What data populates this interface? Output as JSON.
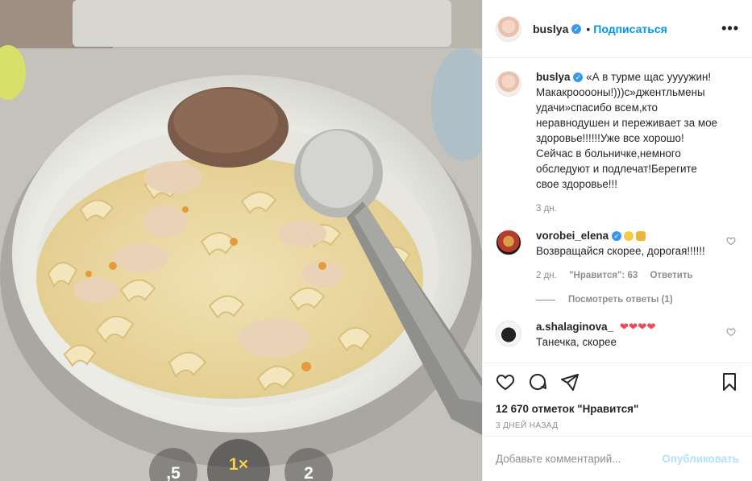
{
  "post": {
    "author": "buslya",
    "follow_label": "Подписаться",
    "dot": "•",
    "more_label": "•••"
  },
  "caption": {
    "author": "buslya",
    "text": "«А в турме щас уууужин! Макакрооооны!)))с»джентльмены удачи»спасибо всем,кто неравнодушен и переживает за мое здоровье!!!!!!Уже все хорошо!Сейчас в больничке,немного обследуют и подлечат!Берегите свое здоровье!!!",
    "time": "3 дн."
  },
  "comments": [
    {
      "author": "vorobei_elena",
      "text": "Возвращайся скорее, дорогая!!!!!!",
      "time": "2 дн.",
      "likes": "\"Нравится\": 63",
      "reply_label": "Ответить",
      "view_replies": "Посмотреть ответы (1)"
    },
    {
      "author": "a.shalaginova_",
      "text": "Танечка, скорее"
    }
  ],
  "actions": {
    "likes_count": "12 670 отметок \"Нравится\"",
    "date": "3 ДНЕЙ НАЗАД"
  },
  "add_comment": {
    "placeholder": "Добавьте комментарий...",
    "publish_label": "Опубликовать"
  },
  "photo": {
    "zoom_options": [
      ",5",
      "1×",
      "2"
    ],
    "zoom_active": "1×"
  },
  "colors": {
    "accent": "#0095f6",
    "verified": "#3897f0",
    "heart_red": "#ed4956",
    "zoom_active": "#f6d24a"
  },
  "icons": [
    "verified-icon",
    "more-icon",
    "heart-icon",
    "comment-icon",
    "share-icon",
    "bookmark-icon",
    "heart-outline-icon",
    "laughing-emoji-icon",
    "praying-hands-icon"
  ]
}
